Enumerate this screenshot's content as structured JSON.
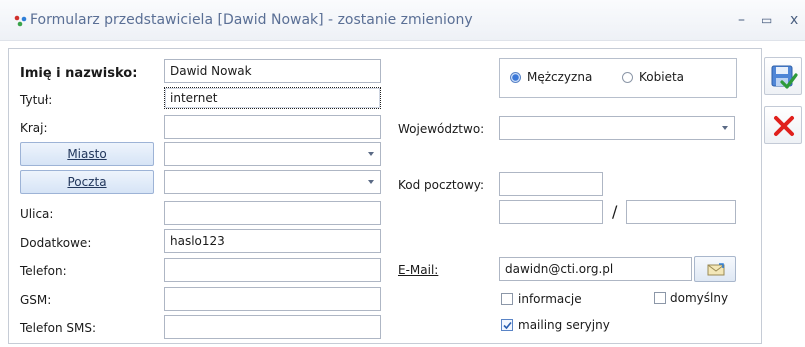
{
  "window": {
    "title": "Formularz przedstawiciela [Dawid Nowak] - zostanie zmieniony",
    "minimize": "–",
    "maximize": "▭",
    "close": "x"
  },
  "left": {
    "name_label": "Imię i nazwisko:",
    "name_value": "Dawid Nowak",
    "title_label": "Tytuł:",
    "title_value": "internet",
    "country_label": "Kraj:",
    "country_value": "",
    "city_button": "Miasto",
    "city_value": "",
    "post_button": "Poczta",
    "post_value": "",
    "street_label": "Ulica:",
    "street_value": "",
    "extra_label": "Dodatkowe:",
    "extra_value": "haslo123",
    "phone_label": "Telefon:",
    "phone_value": "",
    "gsm_label": "GSM:",
    "gsm_value": "",
    "sms_label": "Telefon SMS:",
    "sms_value": ""
  },
  "right": {
    "gender": {
      "male_label": "Mężczyzna",
      "female_label": "Kobieta",
      "selected": "male"
    },
    "voivodeship_label": "Województwo:",
    "voivodeship_value": "",
    "postcode_label": "Kod pocztowy:",
    "postcode_value": "",
    "postcode_extra_1": "",
    "postcode_extra_2": "",
    "slash": "/",
    "email_label": "E-Mail:",
    "email_value": "dawidn@cti.org.pl",
    "info_label": "informacje",
    "info_checked": false,
    "default_label": "domyślny",
    "default_checked": false,
    "mailing_label": "mailing seryjny",
    "mailing_checked": true
  },
  "icons": {
    "title": "representative-form-icon",
    "save": "save-icon",
    "cancel": "cancel-icon",
    "email": "send-email-icon"
  },
  "colors": {
    "title_text": "#5a6f95",
    "cancel_red": "#e0201c",
    "button_blue": "#d6e4f6",
    "radio_selected": "#3b78d8"
  }
}
